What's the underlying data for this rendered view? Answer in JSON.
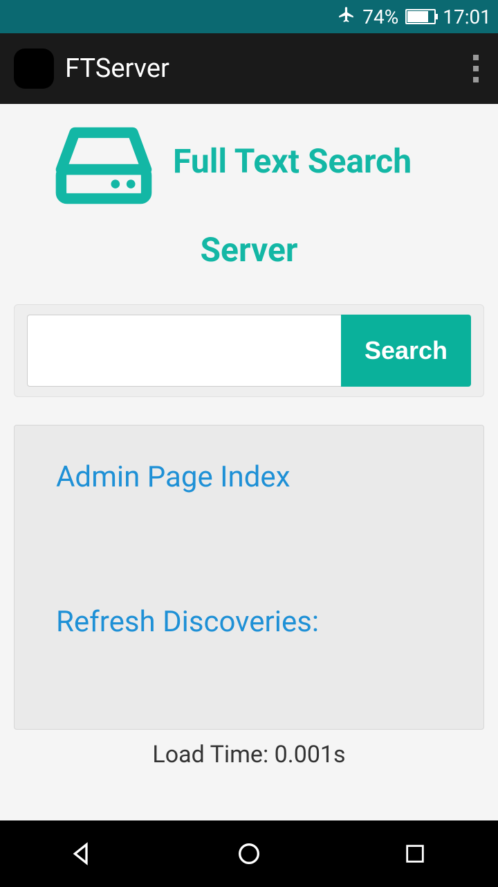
{
  "status": {
    "battery_pct": "74%",
    "time": "17:01"
  },
  "action_bar": {
    "title": "FTServer"
  },
  "hero": {
    "title_line1": "Full Text Search",
    "title_line2": "Server"
  },
  "search": {
    "value": "",
    "button": "Search"
  },
  "panel": {
    "admin_link": "Admin Page Index",
    "refresh_link": "Refresh Discoveries:"
  },
  "footer": {
    "loadtime": "Load Time: 0.001s"
  }
}
